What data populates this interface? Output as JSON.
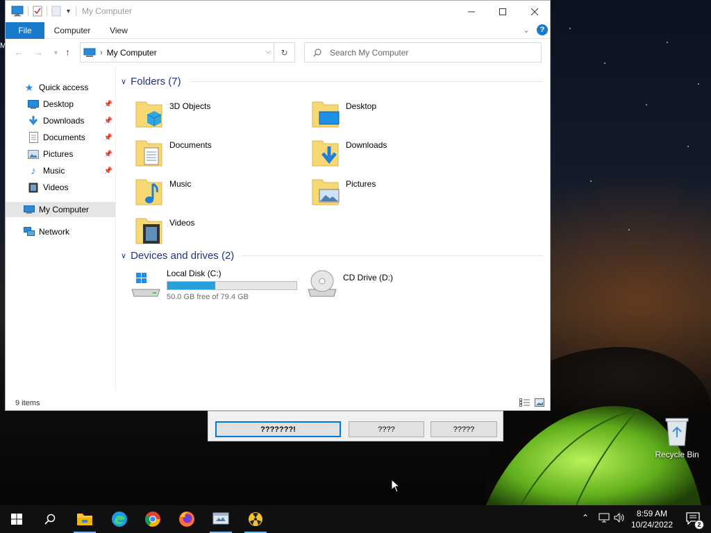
{
  "window": {
    "title": "My Computer",
    "ribbon_tabs": {
      "file": "File",
      "computer": "Computer",
      "view": "View"
    },
    "help": "?"
  },
  "navigation": {
    "address": "My Computer",
    "search_placeholder": "Search My Computer"
  },
  "nav_pane": {
    "quick_access": "Quick access",
    "pinned": [
      {
        "label": "Desktop",
        "icon": "desktop-icon",
        "pinned": true
      },
      {
        "label": "Downloads",
        "icon": "downloads-icon",
        "pinned": true
      },
      {
        "label": "Documents",
        "icon": "documents-icon",
        "pinned": true
      },
      {
        "label": "Pictures",
        "icon": "pictures-icon",
        "pinned": true
      },
      {
        "label": "Music",
        "icon": "music-icon",
        "pinned": true
      },
      {
        "label": "Videos",
        "icon": "videos-icon",
        "pinned": false
      }
    ],
    "this_pc": "My Computer",
    "network": "Network"
  },
  "content": {
    "folders_header": "Folders (7)",
    "folders": [
      {
        "label": "3D Objects",
        "icon": "3d-objects-folder-icon"
      },
      {
        "label": "Desktop",
        "icon": "desktop-folder-icon"
      },
      {
        "label": "Documents",
        "icon": "documents-folder-icon"
      },
      {
        "label": "Downloads",
        "icon": "downloads-folder-icon"
      },
      {
        "label": "Music",
        "icon": "music-folder-icon"
      },
      {
        "label": "Pictures",
        "icon": "pictures-folder-icon"
      },
      {
        "label": "Videos",
        "icon": "videos-folder-icon"
      }
    ],
    "devices_header": "Devices and drives (2)",
    "drives": [
      {
        "label": "Local Disk (C:)",
        "free_text": "50.0 GB free of 79.4 GB",
        "used_fraction": 0.37
      },
      {
        "label": "CD Drive (D:)"
      }
    ]
  },
  "status": {
    "items": "9 items"
  },
  "dialog": {
    "buttons": [
      "???????!",
      "????",
      "?????"
    ]
  },
  "desktop": {
    "recycle_bin": "Recycle Bin",
    "edge_stub": "M"
  },
  "taskbar": {
    "time": "8:59 AM",
    "date": "10/24/2022",
    "notification_count": "2",
    "apps": [
      "start",
      "search",
      "file-explorer",
      "edge",
      "chrome",
      "firefox",
      "app5",
      "app6"
    ]
  },
  "colors": {
    "accent": "#1979ca",
    "group_header": "#1e3287",
    "drive_bar": "#26a0da",
    "taskbar": "#101010"
  }
}
